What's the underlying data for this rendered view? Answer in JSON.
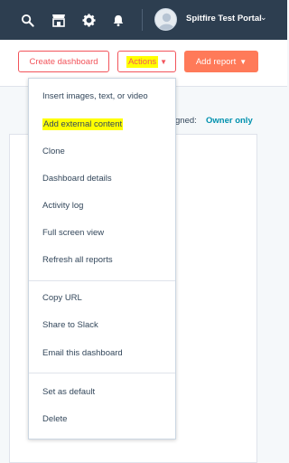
{
  "topbar": {
    "icons": [
      "search-icon",
      "marketplace-icon",
      "gear-icon",
      "bell-icon"
    ],
    "portal_name": "Spitfire Test Portal"
  },
  "header": {
    "create_dashboard_label": "Create dashboard",
    "actions_label": "Actions",
    "add_report_label": "Add report"
  },
  "background": {
    "assigned_partial": "gned:",
    "owner_only": "Owner only"
  },
  "actions_menu": {
    "items": [
      "Insert images, text, or video",
      "Add external content",
      "Clone",
      "Dashboard details",
      "Activity log",
      "Full screen view",
      "Refresh all reports",
      "Copy URL",
      "Share to Slack",
      "Email this dashboard",
      "Set as default",
      "Delete"
    ],
    "highlighted_item": "Add external content",
    "highlight_color": "#ffff00"
  },
  "colors": {
    "nav_bg": "#2d3e50",
    "accent": "#f2545b",
    "add_button": "#ff7a59",
    "link": "#0091ae"
  }
}
